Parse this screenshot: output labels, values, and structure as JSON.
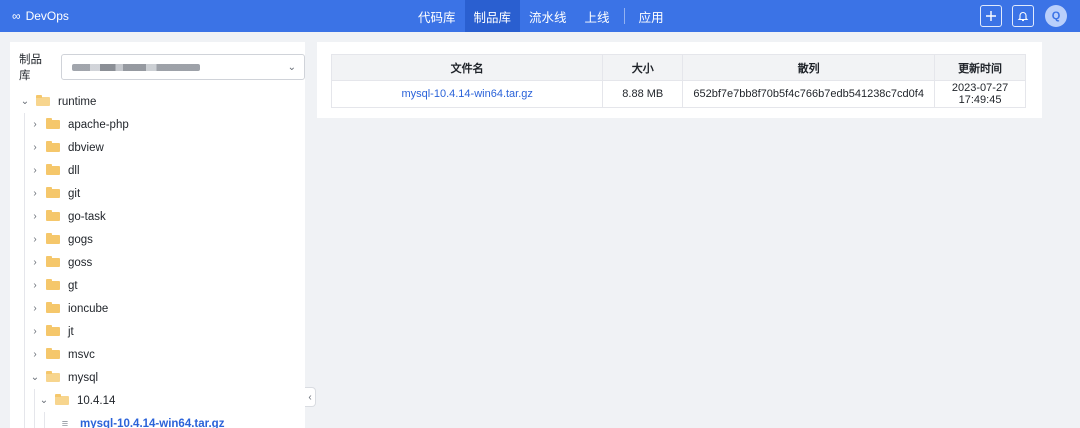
{
  "brand": {
    "icon": "infinity-icon",
    "name": "DevOps"
  },
  "nav": {
    "items": [
      {
        "label": "代码库",
        "active": false
      },
      {
        "label": "制品库",
        "active": true
      },
      {
        "label": "流水线",
        "active": false
      },
      {
        "label": "上线",
        "active": false
      },
      {
        "label": "应用",
        "active": false
      }
    ]
  },
  "toolbar": {
    "add_icon": "plus-icon",
    "bell_icon": "bell-icon",
    "avatar_initial": "Q"
  },
  "sidebar": {
    "repo_label": "制品库",
    "repo_value_blurred": true,
    "tree": [
      {
        "label": "runtime",
        "level": 0,
        "expanded": true,
        "type": "folder"
      },
      {
        "label": "apache-php",
        "level": 1,
        "expanded": false,
        "type": "folder"
      },
      {
        "label": "dbview",
        "level": 1,
        "expanded": false,
        "type": "folder"
      },
      {
        "label": "dll",
        "level": 1,
        "expanded": false,
        "type": "folder"
      },
      {
        "label": "git",
        "level": 1,
        "expanded": false,
        "type": "folder"
      },
      {
        "label": "go-task",
        "level": 1,
        "expanded": false,
        "type": "folder"
      },
      {
        "label": "gogs",
        "level": 1,
        "expanded": false,
        "type": "folder"
      },
      {
        "label": "goss",
        "level": 1,
        "expanded": false,
        "type": "folder"
      },
      {
        "label": "gt",
        "level": 1,
        "expanded": false,
        "type": "folder"
      },
      {
        "label": "ioncube",
        "level": 1,
        "expanded": false,
        "type": "folder"
      },
      {
        "label": "jt",
        "level": 1,
        "expanded": false,
        "type": "folder"
      },
      {
        "label": "msvc",
        "level": 1,
        "expanded": false,
        "type": "folder"
      },
      {
        "label": "mysql",
        "level": 1,
        "expanded": true,
        "type": "folder"
      },
      {
        "label": "10.4.14",
        "level": 2,
        "expanded": true,
        "type": "folder"
      },
      {
        "label": "mysql-10.4.14-win64.tar.gz",
        "level": 3,
        "type": "file",
        "selected": true
      }
    ]
  },
  "table": {
    "headers": [
      "文件名",
      "大小",
      "散列",
      "更新时间"
    ],
    "rows": [
      [
        "mysql-10.4.14-win64.tar.gz",
        "8.88 MB",
        "652bf7e7bb8f70b5f4c766b7edb541238c7cd0f4",
        "2023-07-27 17:49:45"
      ]
    ]
  },
  "colors": {
    "accent": "#3b73e6",
    "link": "#2b63d9",
    "folder": "#f5c76b"
  }
}
